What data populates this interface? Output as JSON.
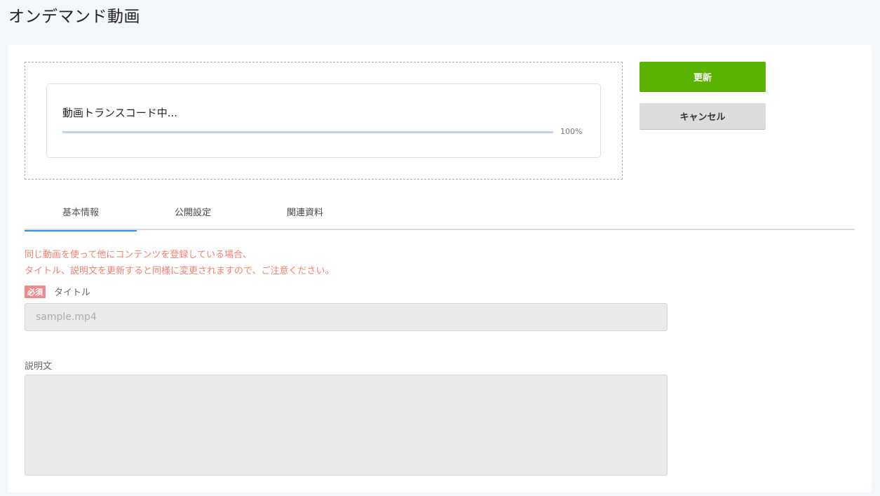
{
  "header": {
    "title": "オンデマンド動画"
  },
  "upload": {
    "status_label": "動画トランスコード中...",
    "progress": 100,
    "progress_text": "100%"
  },
  "actions": {
    "update_label": "更新",
    "cancel_label": "キャンセル"
  },
  "tabs": [
    {
      "label": "基本情報",
      "active": true
    },
    {
      "label": "公開設定",
      "active": false
    },
    {
      "label": "関連資料",
      "active": false
    }
  ],
  "notice": {
    "line1": "同じ動画を使って他にコンテンツを登録している場合、",
    "line2": "タイトル、説明文を更新すると同様に変更されますので、ご注意ください。"
  },
  "form": {
    "required_badge": "必須",
    "title_label": "タイトル",
    "title_placeholder": "sample.mp4",
    "description_label": "説明文",
    "description_value": ""
  },
  "colors": {
    "accent": "#5ab300",
    "tab_active": "#3a8ee6",
    "notice": "#f08070",
    "required": "#f08b8b"
  }
}
